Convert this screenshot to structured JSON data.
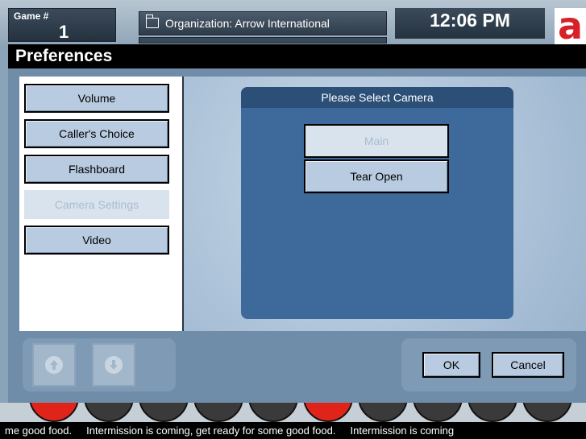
{
  "header": {
    "game_label": "Game #",
    "game_number": "1",
    "organization": "Organization: Arrow International",
    "clock": "12:06 PM",
    "logo_letter": "a"
  },
  "page": {
    "title": "Preferences"
  },
  "menu": {
    "items": [
      {
        "label": "Volume",
        "active": false
      },
      {
        "label": "Caller's Choice",
        "active": false
      },
      {
        "label": "Flashboard",
        "active": false
      },
      {
        "label": "Camera Settings",
        "active": true
      },
      {
        "label": "Video",
        "active": false
      }
    ]
  },
  "camera": {
    "heading": "Please Select Camera",
    "options": [
      {
        "label": "Main",
        "selected": true
      },
      {
        "label": "Tear Open",
        "selected": false
      }
    ]
  },
  "footer": {
    "up_icon": "arrow-up-icon",
    "down_icon": "arrow-down-icon",
    "ok_label": "OK",
    "cancel_label": "Cancel"
  },
  "ticker": {
    "text": "me good food.     Intermission is coming, get ready for some good food.     Intermission is coming"
  },
  "colors": {
    "title_bar": "#000000",
    "panel": "#3e6a9b",
    "button": "#b8cbe0",
    "logo_red": "#d72027"
  }
}
